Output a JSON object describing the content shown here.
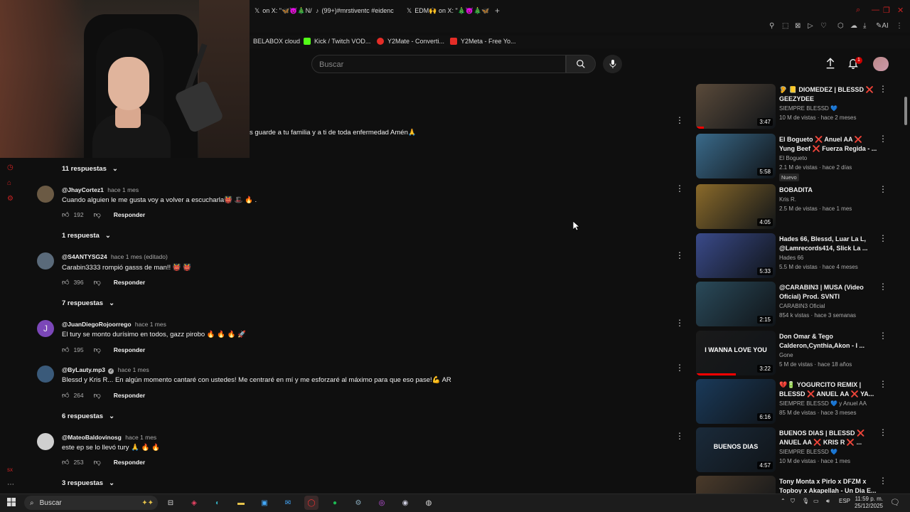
{
  "browser": {
    "tabs": [
      {
        "label": "on X: \"🦋😈🎄N/",
        "icon": "x"
      },
      {
        "label": "(99+)#mrstiventc #eidenc",
        "icon": "tiktok"
      },
      {
        "label": "EDM🙌 on X: \"🎄😈🎄🦋",
        "icon": "x"
      }
    ],
    "bookmarks": [
      {
        "label": "BELABOX cloud",
        "color": "#111111"
      },
      {
        "label": "Kick / Twitch VOD...",
        "color": "#53fc18"
      },
      {
        "label": "Y2Mate - Converti...",
        "color": "#e52d27"
      },
      {
        "label": "Y2Meta - Free Yo...",
        "color": "#e52d27"
      }
    ],
    "toolbar_ai_label": "AI"
  },
  "header": {
    "search_placeholder": "Buscar",
    "notification_count": "1"
  },
  "comments": {
    "partial_text": "s guarde a tu familia y a ti de toda enfermedad Amén🙏",
    "reply_toggles": [
      "11 respuestas",
      "1 respuesta",
      "7 respuestas",
      "6 respuestas",
      "3 respuestas"
    ],
    "items": [
      {
        "author": "@JhayCortez1",
        "time": "hace 1 mes",
        "text": "Cuando alguien le me gusta voy a volver a escucharla👹 🎩 🔥 .",
        "likes": "192",
        "reply": "Responder",
        "avatar_color": "#6b5a44"
      },
      {
        "author": "@S4ANTYSG24",
        "time": "hace 1 mes (editado)",
        "text": "Carabin3333 rompió gasss de man!! 👹 👹",
        "likes": "396",
        "reply": "Responder",
        "avatar_color": "#5a6a7a"
      },
      {
        "author": "@JuanDiegoRojoorrego",
        "time": "hace 1 mes",
        "text": "El tury se monto durísimo en todos, gazz pirobo 🔥 🔥 🔥 🚀",
        "likes": "195",
        "reply": "Responder",
        "avatar_color": "#7b47b8",
        "avatar_letter": "J"
      },
      {
        "author": "@ByLauty.mp3",
        "time": "hace 1 mes",
        "text": "Blessd y Kris R... En algún momento cantaré con ustedes! Me centraré en mí y me esforzaré al máximo para que eso pase!💪 AR",
        "likes": "264",
        "reply": "Responder",
        "avatar_color": "#3a5a7a",
        "verified": true
      },
      {
        "author": "@MateoBaldovinosg",
        "time": "hace 1 mes",
        "text": "este ep se lo llevó tury 🙏 🔥 🔥",
        "likes": "253",
        "reply": "Responder",
        "avatar_color": "#cfcfcf"
      }
    ]
  },
  "recommendations": [
    {
      "title": "🦻 📒 DIOMEDEZ | BLESSD ❌ GEEZYDEE",
      "channel": "SIEMPRE BLESSD 💙",
      "meta": "10 M de vistas · hace 2 meses",
      "duration": "3:47",
      "thumb": "#5a4a3a",
      "progress": 0.1
    },
    {
      "title": "El Bogueto ❌ Anuel AA ❌ Yung Beef ❌ Fuerza Regida - ...",
      "channel": "El Bogueto",
      "meta": "2.1 M de vistas · hace 2 días",
      "badge": "Nuevo",
      "duration": "5:58",
      "thumb": "#3a6a8a"
    },
    {
      "title": "BOBADITA",
      "channel": "Kris R.",
      "meta": "2.5 M de vistas · hace 1 mes",
      "duration": "4:05",
      "thumb": "#8a6a2a"
    },
    {
      "title": "Hades 66, Blessd, Luar La L, @Lamrecords414, Slick La ...",
      "channel": "Hades 66",
      "meta": "5.5 M de vistas · hace 4 meses",
      "duration": "5:33",
      "thumb": "#3a4a8a"
    },
    {
      "title": "@CARABIN3 | MUSA (Video Oficial) Prod. SVNTI",
      "channel": "CARABIN3 Oficial",
      "meta": "854 k vistas · hace 3 semanas",
      "duration": "2:15",
      "thumb": "#2a4a5a"
    },
    {
      "title": "Don Omar & Tego Calderon,Cynthia,Akon - I ...",
      "channel": "Gone",
      "meta": "5 M de vistas · hace 18 años",
      "duration": "3:22",
      "thumb": "#1a1a1a",
      "thumb_text": "I WANNA LOVE YOU",
      "progress": 0.5
    },
    {
      "title": "💔🔋 YOGURCITO REMIX | BLESSD ❌ ANUEL AA ❌ YA...",
      "channel": "SIEMPRE BLESSD 💙 y Anuel AA",
      "meta": "85 M de vistas · hace 3 meses",
      "duration": "6:16",
      "thumb": "#1a3a5a"
    },
    {
      "title": "BUENOS DIAS | BLESSD ❌ ANUEL AA ❌ KRIS R ❌ ...",
      "channel": "SIEMPRE BLESSD 💙",
      "meta": "10 M de vistas · hace 1 mes",
      "duration": "4:57",
      "thumb": "#1a2a3a",
      "thumb_text": "BUENOS DIAS"
    },
    {
      "title": "Tony Monta x Pirlo x DFZM x Topboy x Akapellah - Un Dia E...",
      "channel": "",
      "meta": "",
      "duration": "",
      "thumb": "#4a3a2a"
    }
  ],
  "taskbar": {
    "search_label": "Buscar",
    "language": "ESP",
    "time": "11:59 p. m.",
    "date": "25/12/2025"
  }
}
